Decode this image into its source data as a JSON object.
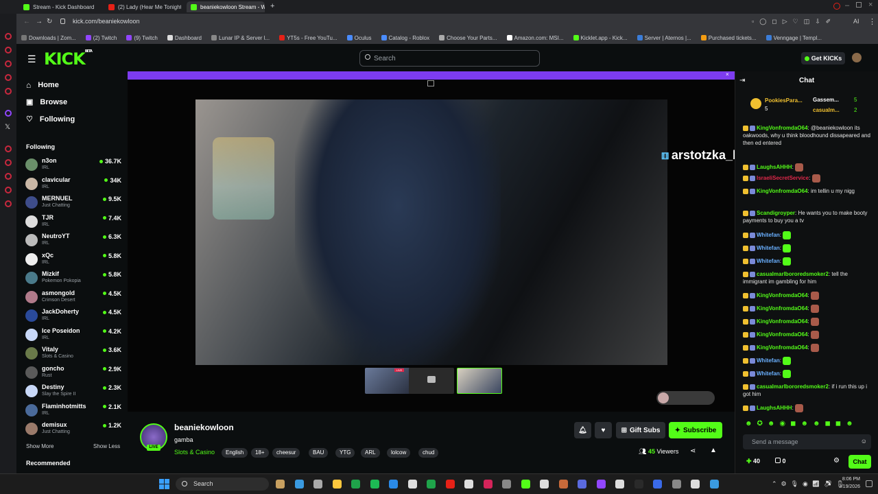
{
  "browser": {
    "tabs": [
      {
        "title": "Stream - Kick Dashboard",
        "color": "#53fc18"
      },
      {
        "title": "(2) Lady (Hear Me Tonight)",
        "color": "#e62117"
      },
      {
        "title": "beaniekowloon Stream - W",
        "color": "#53fc18"
      }
    ],
    "url": "kick.com/beaniekowloon",
    "bookmarks": [
      {
        "label": "Downloads | Zom...",
        "color": "#777"
      },
      {
        "label": "(2) Twitch",
        "color": "#9146ff"
      },
      {
        "label": "(9) Twitch",
        "color": "#9146ff"
      },
      {
        "label": "Dashboard",
        "color": "#ddd"
      },
      {
        "label": "Lunar IP & Server l...",
        "color": "#888"
      },
      {
        "label": "YT5s - Free YouTu...",
        "color": "#e62117"
      },
      {
        "label": "Oculus",
        "color": "#4a8cff"
      },
      {
        "label": "Catalog - Roblox",
        "color": "#4a8cff"
      },
      {
        "label": "Choose Your Parts...",
        "color": "#aaa"
      },
      {
        "label": "Amazon.com: MSI...",
        "color": "#fff"
      },
      {
        "label": "Kicklet.app - Kick...",
        "color": "#53fc18"
      },
      {
        "label": "Server | Aternos |...",
        "color": "#3b7dd8"
      },
      {
        "label": "Purchased tickets...",
        "color": "#f39c12"
      },
      {
        "label": "Venngage | Templ...",
        "color": "#3b7dd8"
      }
    ]
  },
  "kick": {
    "logo": "KICK",
    "logo_sup": "BETA",
    "search_placeholder": "Search",
    "get_kicks": "Get KICKs"
  },
  "sidebar": {
    "nav": [
      {
        "label": "Home",
        "icon": "home-icon"
      },
      {
        "label": "Browse",
        "icon": "browse-icon"
      },
      {
        "label": "Following",
        "icon": "heart-icon"
      }
    ],
    "following_header": "Following",
    "channels": [
      {
        "name": "n3on",
        "category": "IRL",
        "viewers": "36.7K",
        "color": "#6a8f6a"
      },
      {
        "name": "clavicular",
        "category": "IRL",
        "viewers": "34K",
        "color": "#c9b7a6"
      },
      {
        "name": "MERNUEL",
        "category": "Just Chatting",
        "viewers": "9.5K",
        "color": "#3e4d8a"
      },
      {
        "name": "TJR",
        "category": "IRL",
        "viewers": "7.4K",
        "color": "#ddd"
      },
      {
        "name": "NeutroYT",
        "category": "IRL",
        "viewers": "6.3K",
        "color": "#bbb"
      },
      {
        "name": "xQc",
        "category": "IRL",
        "viewers": "5.8K",
        "color": "#eee"
      },
      {
        "name": "Mizkif",
        "category": "Pokemon Pokopia",
        "viewers": "5.8K",
        "color": "#4a7a8a"
      },
      {
        "name": "asmongold",
        "category": "Crimson Desert",
        "viewers": "4.5K",
        "color": "#b07a8a"
      },
      {
        "name": "JackDoherty",
        "category": "IRL",
        "viewers": "4.5K",
        "color": "#2a4a9a"
      },
      {
        "name": "Ice Poseidon",
        "category": "IRL",
        "viewers": "4.2K",
        "color": "#c8d8f8"
      },
      {
        "name": "Vitaly",
        "category": "Slots & Casino",
        "viewers": "3.6K",
        "color": "#6a7a4a"
      },
      {
        "name": "goncho",
        "category": "Rust",
        "viewers": "2.9K",
        "color": "#5a5a5a"
      },
      {
        "name": "Destiny",
        "category": "Slay the Spire II",
        "viewers": "2.3K",
        "color": "#c8d8f8"
      },
      {
        "name": "Flaminhotmitts",
        "category": "IRL",
        "viewers": "2.1K",
        "color": "#4a6a9a"
      },
      {
        "name": "demisux",
        "category": "Just Chatting",
        "viewers": "1.2K",
        "color": "#9a7a6a"
      }
    ],
    "show_more": "Show More",
    "show_less": "Show Less",
    "recommended": "Recommended"
  },
  "stream": {
    "streamer": "beaniekowloon",
    "title": "gamba",
    "category": "Slots & Casino",
    "live_badge": "LIVE",
    "tags": [
      "English",
      "18+",
      "cheesur",
      "BAU",
      "YTG",
      "ARL",
      "lolcow",
      "chud"
    ],
    "viewers": "45",
    "viewers_label": "Viewers",
    "gift_subs": "Gift Subs",
    "subscribe": "Subscribe",
    "overlay_text": "arstotzka_bordercontrol : Answ"
  },
  "chat": {
    "header": "Chat",
    "pinned": [
      {
        "name": "PookiesPara...",
        "count": "5"
      },
      {
        "name": "Gassem...",
        "count": "5"
      },
      {
        "name": "casualm...",
        "count": "2"
      }
    ],
    "messages": [
      {
        "user": "KingVonfromdaO64",
        "user_color": "#53fc18",
        "text": "@beaniekowloon its oakwoods, why u think bloodhound dissapeared and then ed entered"
      },
      {
        "user": "LaughsAHHH",
        "user_color": "#53fc18",
        "text": ""
      },
      {
        "user": "IsraeliSecretService",
        "user_color": "#e0284a",
        "text": ""
      },
      {
        "user": "KingVonfromdaO64",
        "user_color": "#53fc18",
        "text": "im tellin u my nigg"
      },
      {
        "user": "Scandigroyper",
        "user_color": "#53fc18",
        "text": "He wants you to make booty payments to buy you a tv"
      },
      {
        "user": "Whitefan",
        "user_color": "#6ab0ff",
        "text": ""
      },
      {
        "user": "Whitefan",
        "user_color": "#6ab0ff",
        "text": ""
      },
      {
        "user": "Whitefan",
        "user_color": "#6ab0ff",
        "text": ""
      },
      {
        "user": "casualmarlbororedsmoker2",
        "user_color": "#53fc18",
        "text": "tell the immigrant im gambling for him"
      },
      {
        "user": "KingVonfromdaO64",
        "user_color": "#53fc18",
        "text": ""
      },
      {
        "user": "KingVonfromdaO64",
        "user_color": "#53fc18",
        "text": ""
      },
      {
        "user": "KingVonfromdaO64",
        "user_color": "#53fc18",
        "text": ""
      },
      {
        "user": "KingVonfromdaO64",
        "user_color": "#53fc18",
        "text": ""
      },
      {
        "user": "KingVonfromdaO64",
        "user_color": "#53fc18",
        "text": ""
      },
      {
        "user": "Whitefan",
        "user_color": "#6ab0ff",
        "text": ""
      },
      {
        "user": "Whitefan",
        "user_color": "#6ab0ff",
        "text": ""
      },
      {
        "user": "casualmarlbororedsmoker2",
        "user_color": "#53fc18",
        "text": "if i run this up i got him"
      },
      {
        "user": "LaughsAHHH",
        "user_color": "#53fc18",
        "text": ""
      }
    ],
    "send_placeholder": "Send a message",
    "kicks_count": "40",
    "points_count": "0",
    "chat_button": "Chat"
  },
  "taskbar": {
    "search": "Search",
    "time": "8:06 PM",
    "date": "3/19/2026"
  },
  "colors": {
    "accent": "#53fc18",
    "banner": "#7d3cf0"
  }
}
